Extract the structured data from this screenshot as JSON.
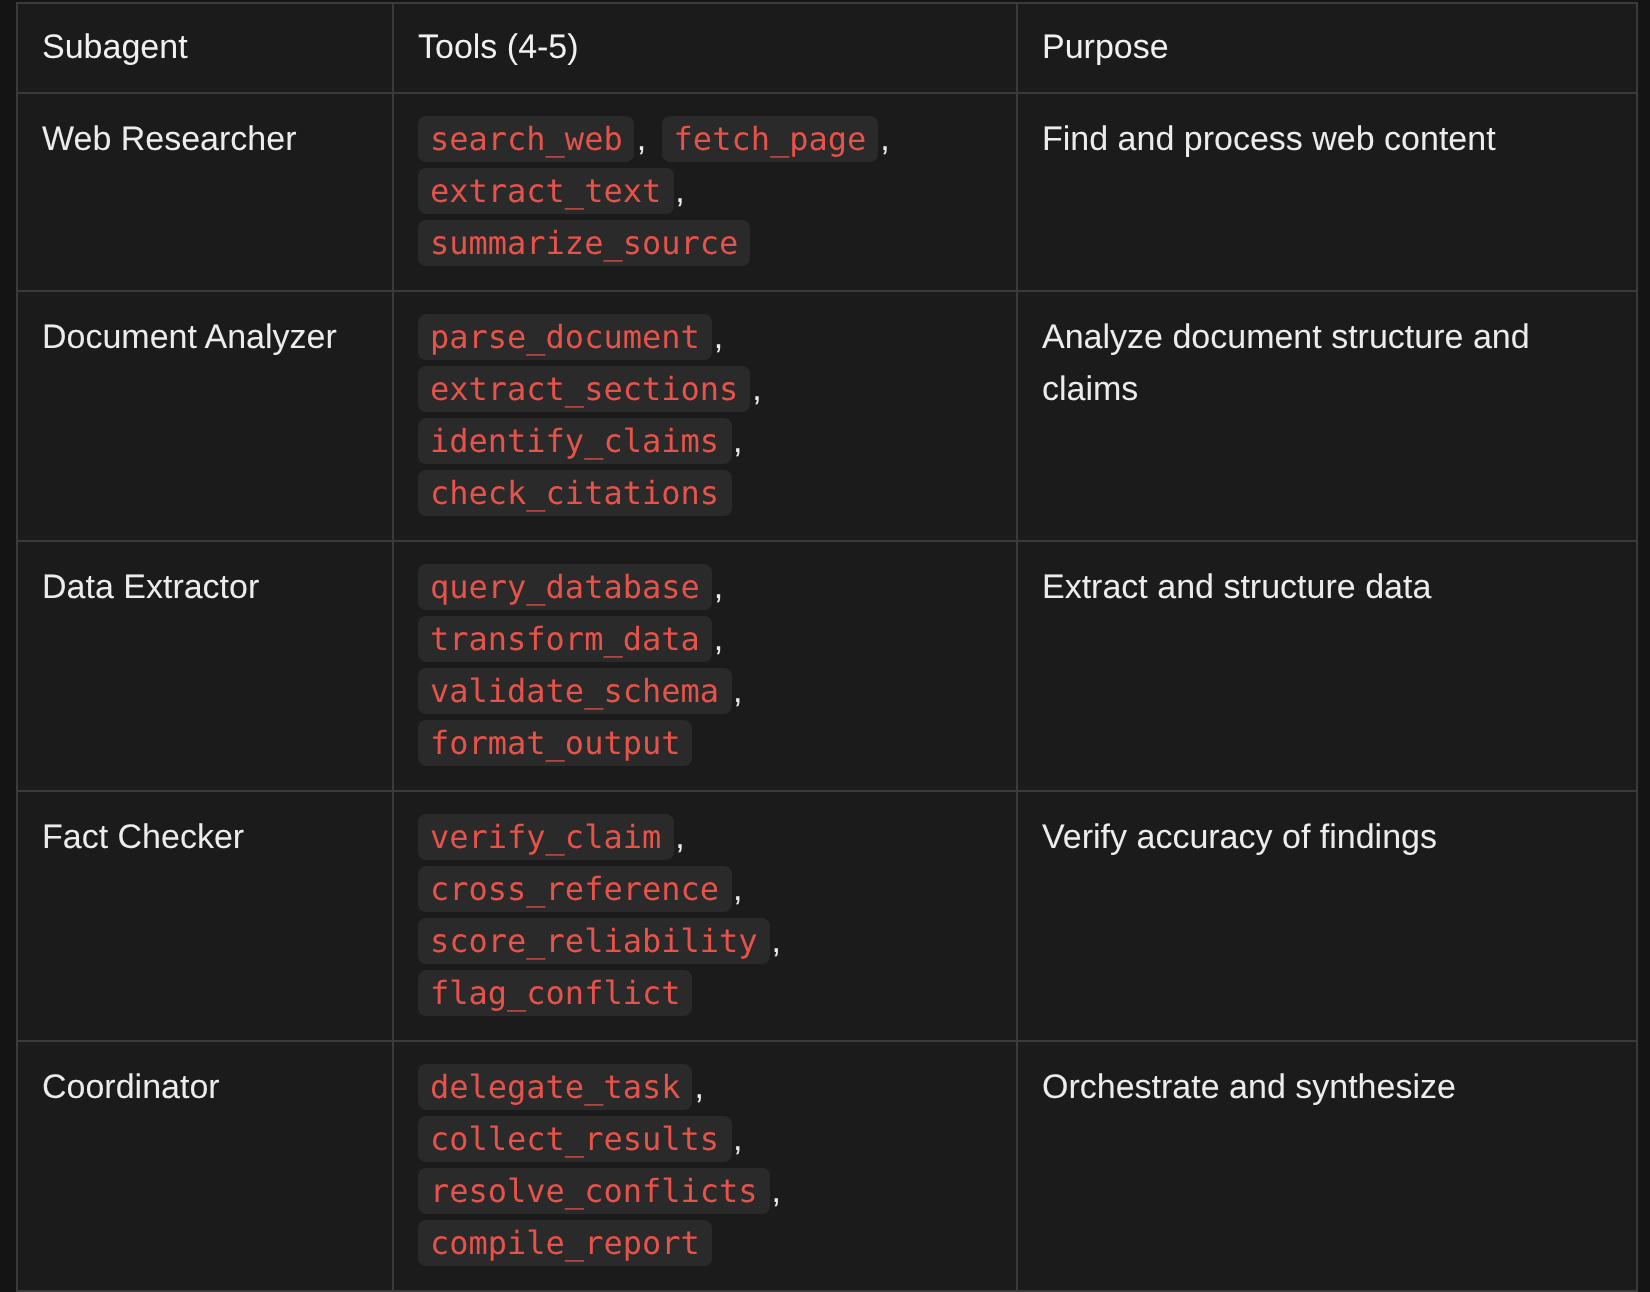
{
  "table": {
    "columns": [
      "Subagent",
      "Tools (4-5)",
      "Purpose"
    ],
    "rows": [
      {
        "subagent": "Web Researcher",
        "tools": [
          {
            "name": "search_web",
            "separator": ","
          },
          {
            "name": "fetch_page",
            "separator": ","
          },
          {
            "name": "extract_text",
            "separator": ","
          },
          {
            "name": "summarize_source"
          }
        ],
        "purpose": "Find and process web content"
      },
      {
        "subagent": "Document Analyzer",
        "tools": [
          {
            "name": "parse_document",
            "separator": ","
          },
          {
            "name": "extract_sections",
            "separator": ","
          },
          {
            "name": "identify_claims",
            "separator": ","
          },
          {
            "name": "check_citations"
          }
        ],
        "purpose": "Analyze document structure and claims"
      },
      {
        "subagent": "Data Extractor",
        "tools": [
          {
            "name": "query_database",
            "separator": ","
          },
          {
            "name": "transform_data",
            "separator": ","
          },
          {
            "name": "validate_schema",
            "separator": ","
          },
          {
            "name": "format_output"
          }
        ],
        "purpose": "Extract and structure data"
      },
      {
        "subagent": "Fact Checker",
        "tools": [
          {
            "name": "verify_claim",
            "separator": ","
          },
          {
            "name": "cross_reference",
            "separator": ","
          },
          {
            "name": "score_reliability",
            "separator": ","
          },
          {
            "name": "flag_conflict"
          }
        ],
        "purpose": "Verify accuracy of findings"
      },
      {
        "subagent": "Coordinator",
        "tools": [
          {
            "name": "delegate_task",
            "separator": ","
          },
          {
            "name": "collect_results",
            "separator": ","
          },
          {
            "name": "resolve_conflicts",
            "separator": ","
          },
          {
            "name": "compile_report"
          }
        ],
        "purpose": "Orchestrate and synthesize"
      }
    ]
  }
}
